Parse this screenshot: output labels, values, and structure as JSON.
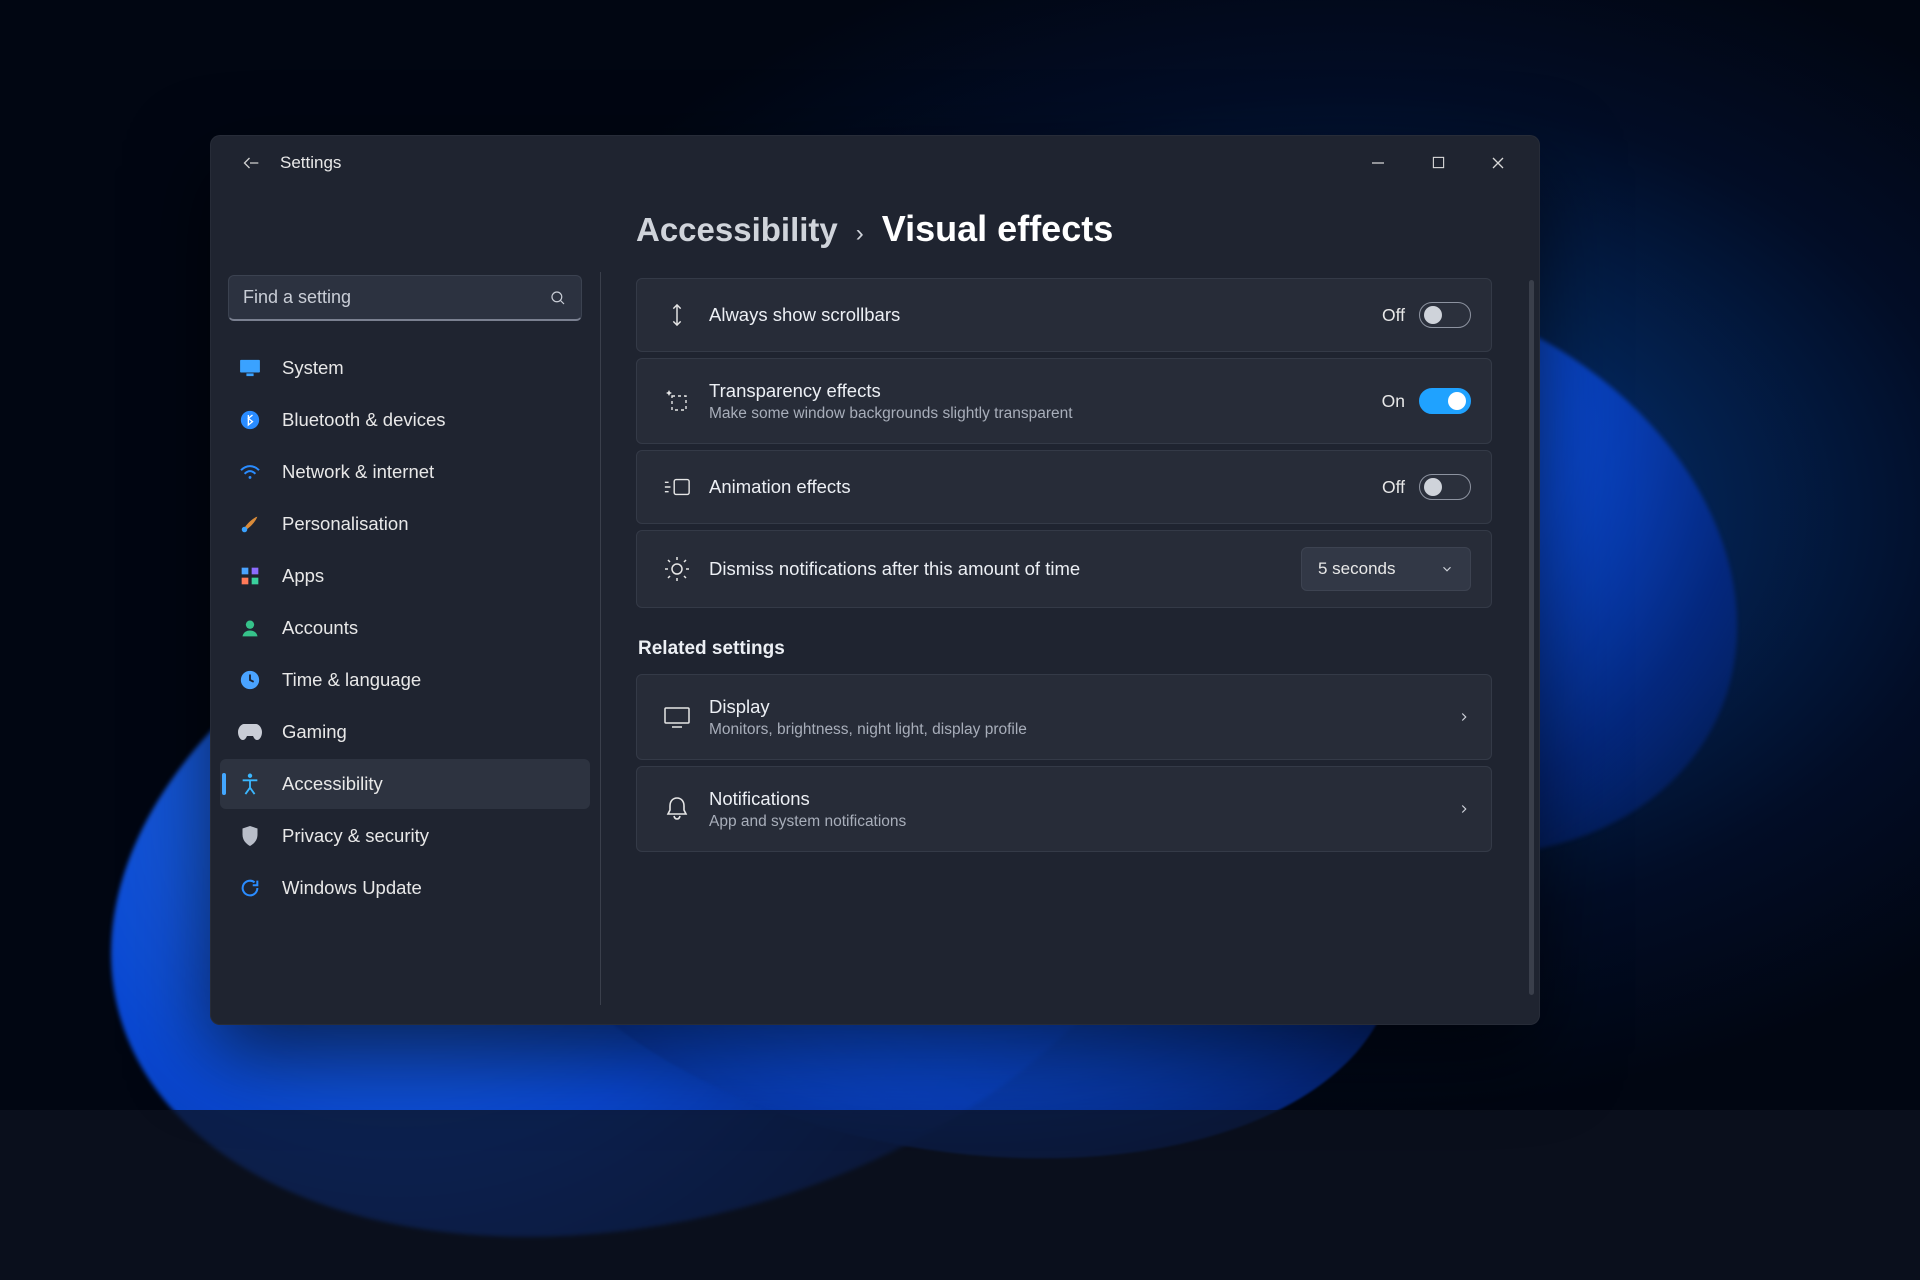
{
  "window": {
    "title": "Settings",
    "back_aria": "Back"
  },
  "search": {
    "placeholder": "Find a setting"
  },
  "sidebar": {
    "items": [
      {
        "key": "system",
        "label": "System",
        "icon": "monitor",
        "selected": false
      },
      {
        "key": "bluetooth",
        "label": "Bluetooth & devices",
        "icon": "bluetooth",
        "selected": false
      },
      {
        "key": "network",
        "label": "Network & internet",
        "icon": "wifi",
        "selected": false
      },
      {
        "key": "personalisation",
        "label": "Personalisation",
        "icon": "brush",
        "selected": false
      },
      {
        "key": "apps",
        "label": "Apps",
        "icon": "grid",
        "selected": false
      },
      {
        "key": "accounts",
        "label": "Accounts",
        "icon": "person",
        "selected": false
      },
      {
        "key": "time",
        "label": "Time & language",
        "icon": "clock",
        "selected": false
      },
      {
        "key": "gaming",
        "label": "Gaming",
        "icon": "gamepad",
        "selected": false
      },
      {
        "key": "accessibility",
        "label": "Accessibility",
        "icon": "access",
        "selected": true
      },
      {
        "key": "privacy",
        "label": "Privacy & security",
        "icon": "shield",
        "selected": false
      },
      {
        "key": "update",
        "label": "Windows Update",
        "icon": "update",
        "selected": false
      }
    ]
  },
  "breadcrumb": {
    "parent": "Accessibility",
    "current": "Visual effects"
  },
  "settings": [
    {
      "key": "scrollbars",
      "icon": "scrollbars",
      "title": "Always show scrollbars",
      "subtitle": "",
      "type": "toggle",
      "value": false,
      "state_label": "Off"
    },
    {
      "key": "transparency",
      "icon": "sparkle",
      "title": "Transparency effects",
      "subtitle": "Make some window backgrounds slightly transparent",
      "type": "toggle",
      "value": true,
      "state_label": "On"
    },
    {
      "key": "animation",
      "icon": "animation",
      "title": "Animation effects",
      "subtitle": "",
      "type": "toggle",
      "value": false,
      "state_label": "Off"
    },
    {
      "key": "dismiss",
      "icon": "brightness",
      "title": "Dismiss notifications after this amount of time",
      "subtitle": "",
      "type": "select",
      "value": "5 seconds"
    }
  ],
  "related_heading": "Related settings",
  "related": [
    {
      "key": "display",
      "icon": "display",
      "title": "Display",
      "subtitle": "Monitors, brightness, night light, display profile"
    },
    {
      "key": "notifications",
      "icon": "bell",
      "title": "Notifications",
      "subtitle": "App and system notifications"
    }
  ]
}
